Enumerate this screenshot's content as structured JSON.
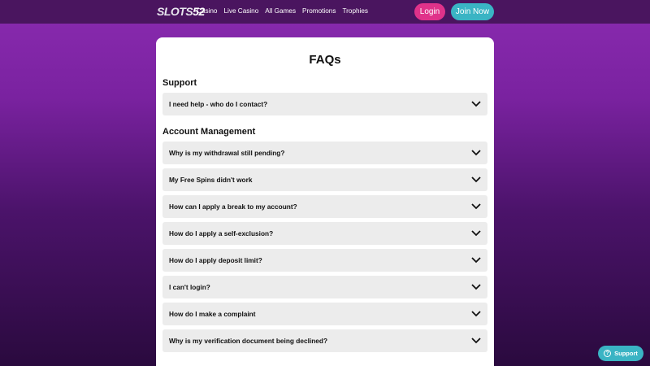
{
  "header": {
    "logo_text": "SLOTS",
    "logo_num": "52",
    "nav": [
      "Casino",
      "Live Casino",
      "All Games",
      "Promotions",
      "Trophies"
    ],
    "login_label": "Login",
    "join_label": "Join Now"
  },
  "page": {
    "title": "FAQs"
  },
  "sections": [
    {
      "title": "Support",
      "items": [
        "I need help - who do I contact?"
      ]
    },
    {
      "title": "Account Management",
      "items": [
        "Why is my withdrawal still pending?",
        "My Free Spins didn't work",
        "How can I apply a break to my account?",
        "How do I apply a self-exclusion?",
        "How do I apply deposit limit?",
        "I can't login?",
        "How do I make a complaint",
        "Why is my verification document being declined?"
      ]
    }
  ],
  "support_widget": {
    "label": "Support",
    "icon": "question-icon"
  },
  "colors": {
    "accent_pink": "#e0328a",
    "accent_teal": "#3ab4c4",
    "bg_purple": "#7a22a0"
  }
}
